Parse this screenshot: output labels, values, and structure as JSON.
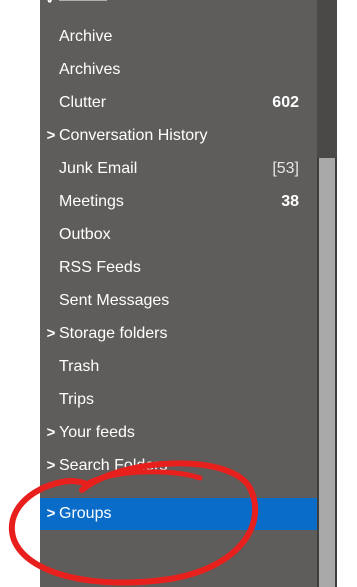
{
  "folders": [
    {
      "label": "Archive",
      "count": "",
      "expandable": false
    },
    {
      "label": "Archives",
      "count": "",
      "expandable": false
    },
    {
      "label": "Clutter",
      "count": "602",
      "expandable": false
    },
    {
      "label": "Conversation History",
      "count": "",
      "expandable": true
    },
    {
      "label": "Junk Email",
      "count": "[53]",
      "expandable": false
    },
    {
      "label": "Meetings",
      "count": "38",
      "expandable": false
    },
    {
      "label": "Outbox",
      "count": "",
      "expandable": false
    },
    {
      "label": "RSS Feeds",
      "count": "",
      "expandable": false
    },
    {
      "label": "Sent Messages",
      "count": "",
      "expandable": false
    },
    {
      "label": "Storage folders",
      "count": "",
      "expandable": true
    },
    {
      "label": "Trash",
      "count": "",
      "expandable": false
    },
    {
      "label": "Trips",
      "count": "",
      "expandable": false
    },
    {
      "label": "Your feeds",
      "count": "",
      "expandable": true
    },
    {
      "label": "Search Folders",
      "count": "",
      "expandable": true
    },
    {
      "label": "Groups",
      "count": "",
      "expandable": true,
      "selected": true
    }
  ],
  "icons": {
    "expand": "chevron-right-icon"
  },
  "colors": {
    "pane_bg": "#5f5d5b",
    "selected_bg": "#0a6cc9",
    "annotation": "#e8201d"
  }
}
